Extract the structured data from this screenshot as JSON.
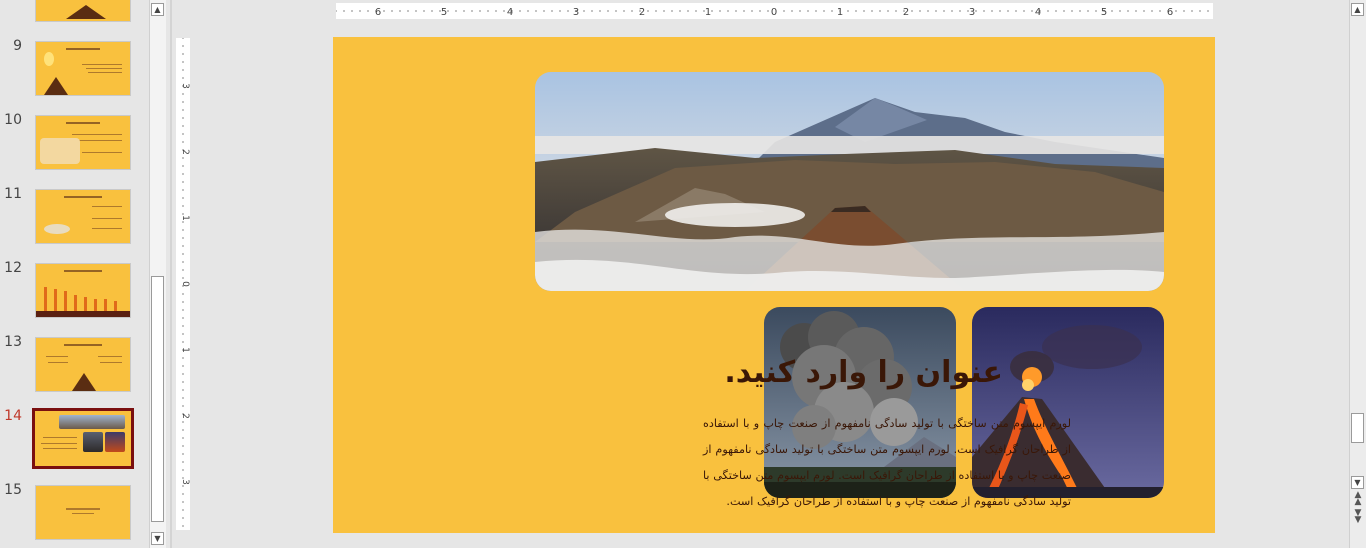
{
  "thumbnails": [
    {
      "number": "9",
      "active": false
    },
    {
      "number": "10",
      "active": false
    },
    {
      "number": "11",
      "active": false
    },
    {
      "number": "12",
      "active": false
    },
    {
      "number": "13",
      "active": false
    },
    {
      "number": "14",
      "active": true
    },
    {
      "number": "15",
      "active": false
    }
  ],
  "ruler": {
    "horizontal_labels": [
      "6",
      "5",
      "4",
      "3",
      "2",
      "1",
      "0",
      "1",
      "2",
      "3",
      "4",
      "5",
      "6"
    ],
    "vertical_labels": [
      "3",
      "2",
      "1",
      "0",
      "1",
      "2",
      "3"
    ]
  },
  "slide": {
    "title": "عنوان را وارد کنید.",
    "body": "لورم ایپسوم متن ساختگی با تولید سادگی نامفهوم از صنعت چاپ و با استفاده از طراحان گرافیک است. لورم ایپسوم متن ساختگی با تولید سادگی نامفهوم از صنعت چاپ و با استفاده از طراحان گرافیک است. لورم ایپسوم متن ساختگی با تولید سادگی نامفهوم از صنعت چاپ و با استفاده از طراحان گرافیک است.",
    "background_color": "#f9c13e",
    "text_color": "#3a1707"
  },
  "icons": {
    "scroll_up": "triangle-up",
    "scroll_down": "triangle-down",
    "prev_slide": "double-up",
    "next_slide": "double-down"
  }
}
